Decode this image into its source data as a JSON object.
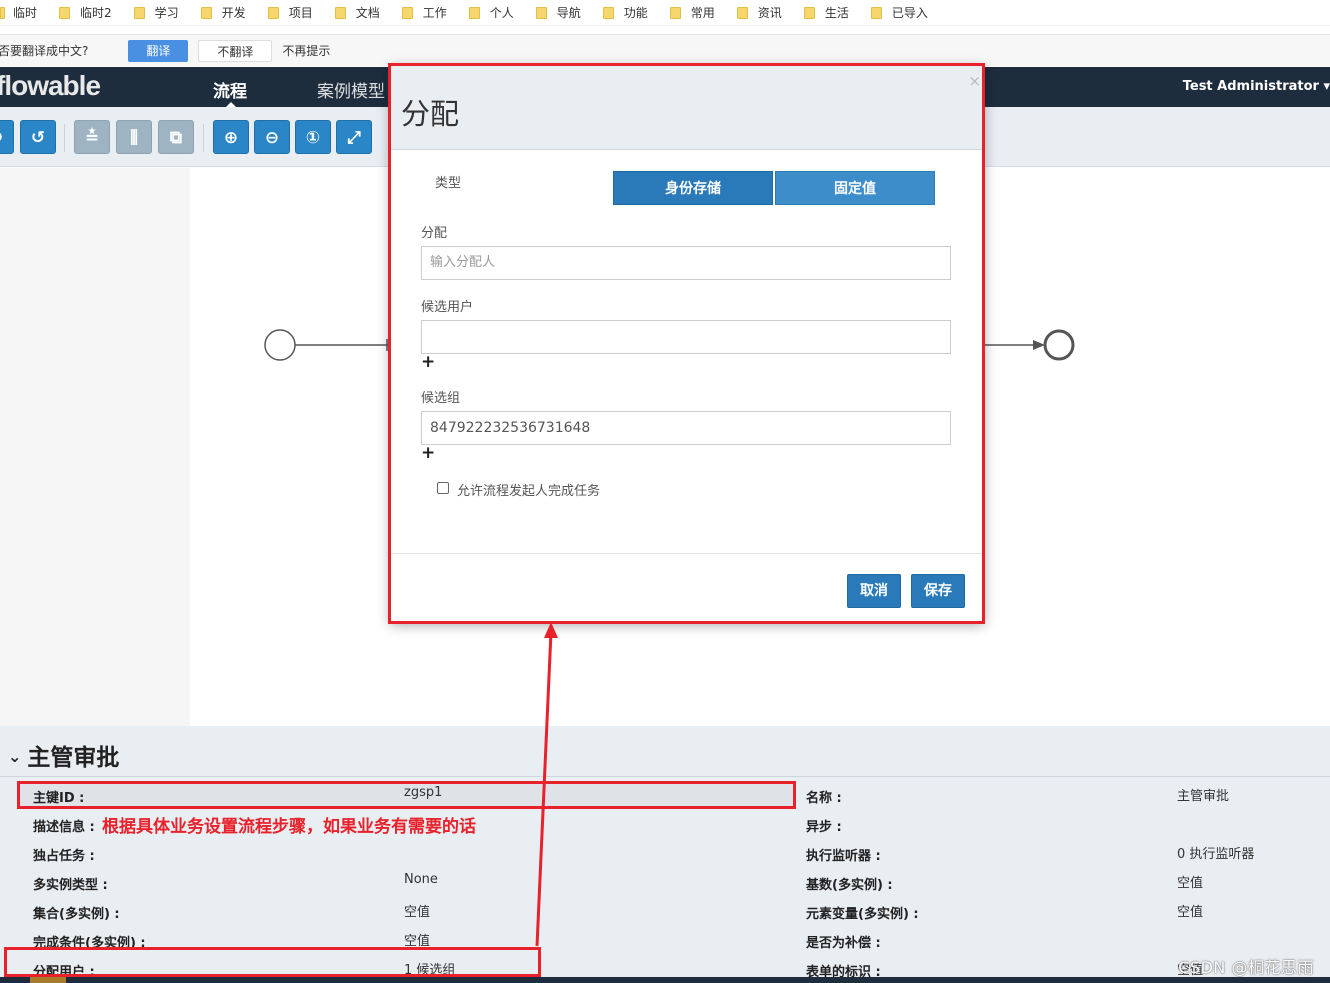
{
  "bookmarks": [
    "临时",
    "临时2",
    "学习",
    "开发",
    "项目",
    "文档",
    "工作",
    "个人",
    "导航",
    "功能",
    "常用",
    "资讯",
    "生活",
    "已导入"
  ],
  "translate_bar": {
    "question": "否要翻译成中文?",
    "translate_btn": "翻译",
    "no_translate_btn": "不翻译",
    "never_link": "不再提示"
  },
  "nav": {
    "logo": "flowable",
    "items": [
      "流程",
      "案例模型"
    ],
    "user": "Test Administrator ▾"
  },
  "toolbar": {
    "icons": [
      "redo-icon",
      "undo-icon",
      "align-horizontal-icon",
      "align-vertical-icon",
      "same-size-icon",
      "zoom-in-icon",
      "zoom-out-icon",
      "zoom-actual-icon",
      "zoom-fit-icon"
    ]
  },
  "modal": {
    "title": "分配",
    "close": "×",
    "type_label": "类型",
    "type_options": [
      "身份存储",
      "固定值"
    ],
    "assignee_label": "分配",
    "assignee_placeholder": "输入分配人",
    "candidate_users_label": "候选用户",
    "candidate_users_value": "",
    "add_user": "+",
    "candidate_groups_label": "候选组",
    "candidate_groups_value": "847922232536731648",
    "add_group": "+",
    "allow_initiator_label": "允许流程发起人完成任务",
    "cancel": "取消",
    "save": "保存"
  },
  "properties": {
    "title": "主管审批",
    "rows_left": [
      {
        "label": "主键ID :",
        "value": "zgsp1"
      },
      {
        "label": "描述信息 :",
        "value": ""
      },
      {
        "label": "独占任务 :",
        "value": ""
      },
      {
        "label": "多实例类型 :",
        "value": "None"
      },
      {
        "label": "集合(多实例) :",
        "value": "空值"
      },
      {
        "label": "完成条件(多实例) :",
        "value": "空值"
      },
      {
        "label": "分配用户 :",
        "value": "1 候选组"
      }
    ],
    "rows_right": [
      {
        "label": "名称 :",
        "value": "主管审批"
      },
      {
        "label": "异步 :",
        "value": ""
      },
      {
        "label": "执行监听器 :",
        "value": "0 执行监听器"
      },
      {
        "label": "基数(多实例) :",
        "value": "空值"
      },
      {
        "label": "元素变量(多实例) :",
        "value": "空值"
      },
      {
        "label": "是否为补偿 :",
        "value": ""
      },
      {
        "label": "表单的标识 :",
        "value": "空值"
      }
    ]
  },
  "annotation": "根据具体业务设置流程步骤，如果业务有需要的话",
  "watermark": "CSDN @桐花思雨",
  "colors": {
    "nav": "#1d2d3e",
    "accent": "#2a7ab9",
    "annotation": "#e8212b"
  }
}
